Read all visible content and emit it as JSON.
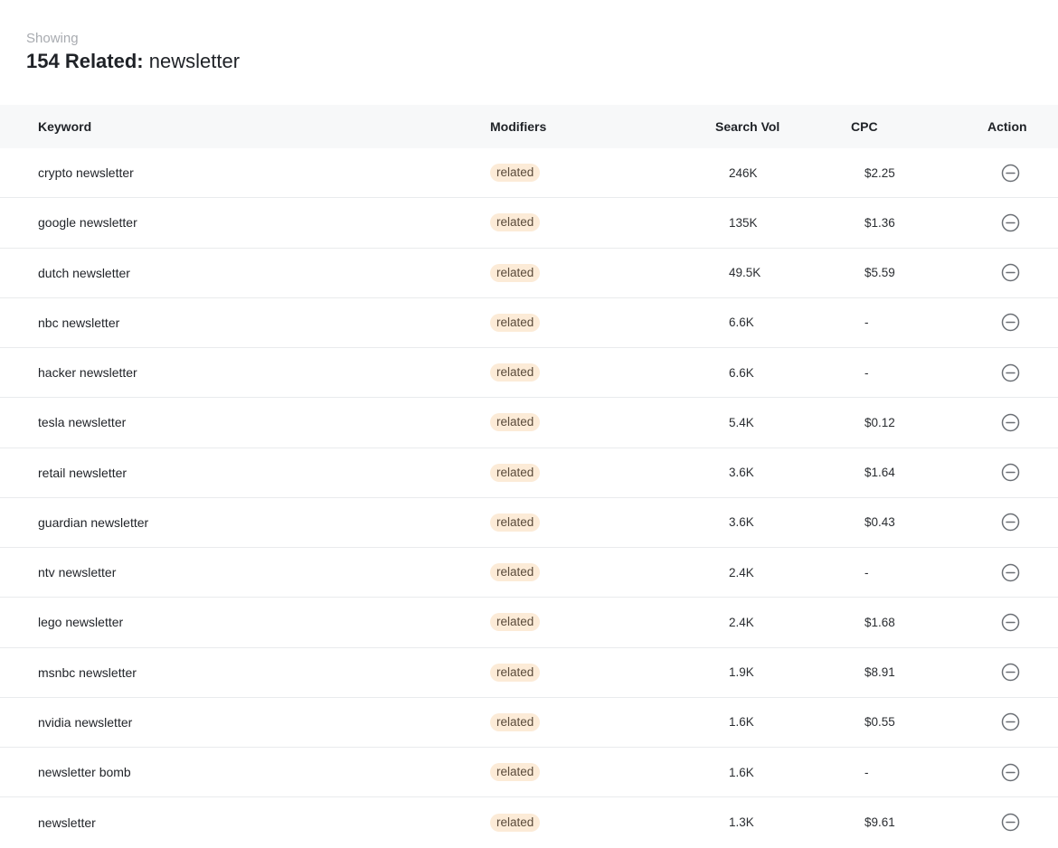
{
  "header": {
    "showing_label": "Showing",
    "count_label": "154 Related:",
    "query": "newsletter"
  },
  "columns": {
    "keyword": "Keyword",
    "modifiers": "Modifiers",
    "search_vol": "Search Vol",
    "cpc": "CPC",
    "action": "Action"
  },
  "colors": {
    "badge_bg": "#fcebd7",
    "header_bg": "#f7f8f9",
    "icon": "#6b6f75"
  },
  "action_icon": "remove-circle-icon",
  "rows": [
    {
      "keyword": "crypto newsletter",
      "modifier": "related",
      "volume": "246K",
      "cpc": "$2.25"
    },
    {
      "keyword": "google newsletter",
      "modifier": "related",
      "volume": "135K",
      "cpc": "$1.36"
    },
    {
      "keyword": "dutch newsletter",
      "modifier": "related",
      "volume": "49.5K",
      "cpc": "$5.59"
    },
    {
      "keyword": "nbc newsletter",
      "modifier": "related",
      "volume": "6.6K",
      "cpc": "-"
    },
    {
      "keyword": "hacker newsletter",
      "modifier": "related",
      "volume": "6.6K",
      "cpc": "-"
    },
    {
      "keyword": "tesla newsletter",
      "modifier": "related",
      "volume": "5.4K",
      "cpc": "$0.12"
    },
    {
      "keyword": "retail newsletter",
      "modifier": "related",
      "volume": "3.6K",
      "cpc": "$1.64"
    },
    {
      "keyword": "guardian newsletter",
      "modifier": "related",
      "volume": "3.6K",
      "cpc": "$0.43"
    },
    {
      "keyword": "ntv newsletter",
      "modifier": "related",
      "volume": "2.4K",
      "cpc": "-"
    },
    {
      "keyword": "lego newsletter",
      "modifier": "related",
      "volume": "2.4K",
      "cpc": "$1.68"
    },
    {
      "keyword": "msnbc newsletter",
      "modifier": "related",
      "volume": "1.9K",
      "cpc": "$8.91"
    },
    {
      "keyword": "nvidia newsletter",
      "modifier": "related",
      "volume": "1.6K",
      "cpc": "$0.55"
    },
    {
      "keyword": "newsletter bomb",
      "modifier": "related",
      "volume": "1.6K",
      "cpc": "-"
    },
    {
      "keyword": "newsletter",
      "modifier": "related",
      "volume": "1.3K",
      "cpc": "$9.61"
    }
  ]
}
